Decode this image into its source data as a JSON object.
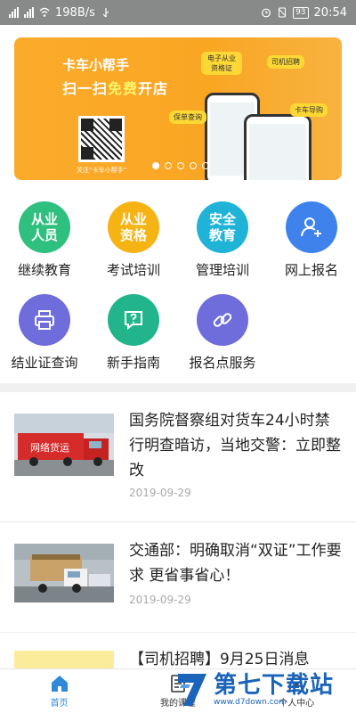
{
  "status_bar": {
    "net_left": "3G",
    "net_left2": "4G",
    "speed": "198B/s",
    "battery": "93",
    "time": "20:54"
  },
  "banner": {
    "title": "卡车小帮手",
    "subtitle_pre": "扫一扫",
    "subtitle_em": "免费",
    "subtitle_post": "开店",
    "qr_caption": "关注“卡车小帮手”",
    "bubbles": [
      "电子从业资格证",
      "司机招聘",
      "保单查询",
      "卡车导购"
    ],
    "dots_count": 5,
    "active_dot": 1
  },
  "grid": [
    {
      "circle": "从业\n人员",
      "label": "继续教育",
      "color": "#2fbf7e",
      "icon": ""
    },
    {
      "circle": "从业\n资格",
      "label": "考试培训",
      "color": "#f6b414",
      "icon": ""
    },
    {
      "circle": "安全\n教育",
      "label": "管理培训",
      "color": "#1fb3d8",
      "icon": ""
    },
    {
      "circle": "",
      "label": "网上报名",
      "color": "#3f82ec",
      "icon": "add-user-icon"
    },
    {
      "circle": "",
      "label": "结业证查询",
      "color": "#6f6cdb",
      "icon": "printer-icon"
    },
    {
      "circle": "",
      "label": "新手指南",
      "color": "#22b58b",
      "icon": "question-icon"
    },
    {
      "circle": "",
      "label": "报名点服务",
      "color": "#6f6cdb",
      "icon": "link-icon"
    }
  ],
  "news": [
    {
      "title": "国务院督察组对货车24小时禁行明查暗访，当地交警：立即整改",
      "date": "2019-09-29"
    },
    {
      "title": "交通部：明确取消“双证”工作要求 更省事省心！",
      "date": "2019-09-29"
    },
    {
      "title": "【司机招聘】9月25日消息",
      "date": ""
    }
  ],
  "tabs": [
    {
      "label": "首页",
      "icon": "home-icon"
    },
    {
      "label": "我的课程",
      "icon": "document-icon"
    },
    {
      "label": "个人中心",
      "icon": "person-icon"
    }
  ],
  "watermark": {
    "text": "第七下载站",
    "url": "www.d7down.com"
  },
  "colors": {
    "accent": "#2f88d8",
    "banner": "#fbab2a"
  }
}
